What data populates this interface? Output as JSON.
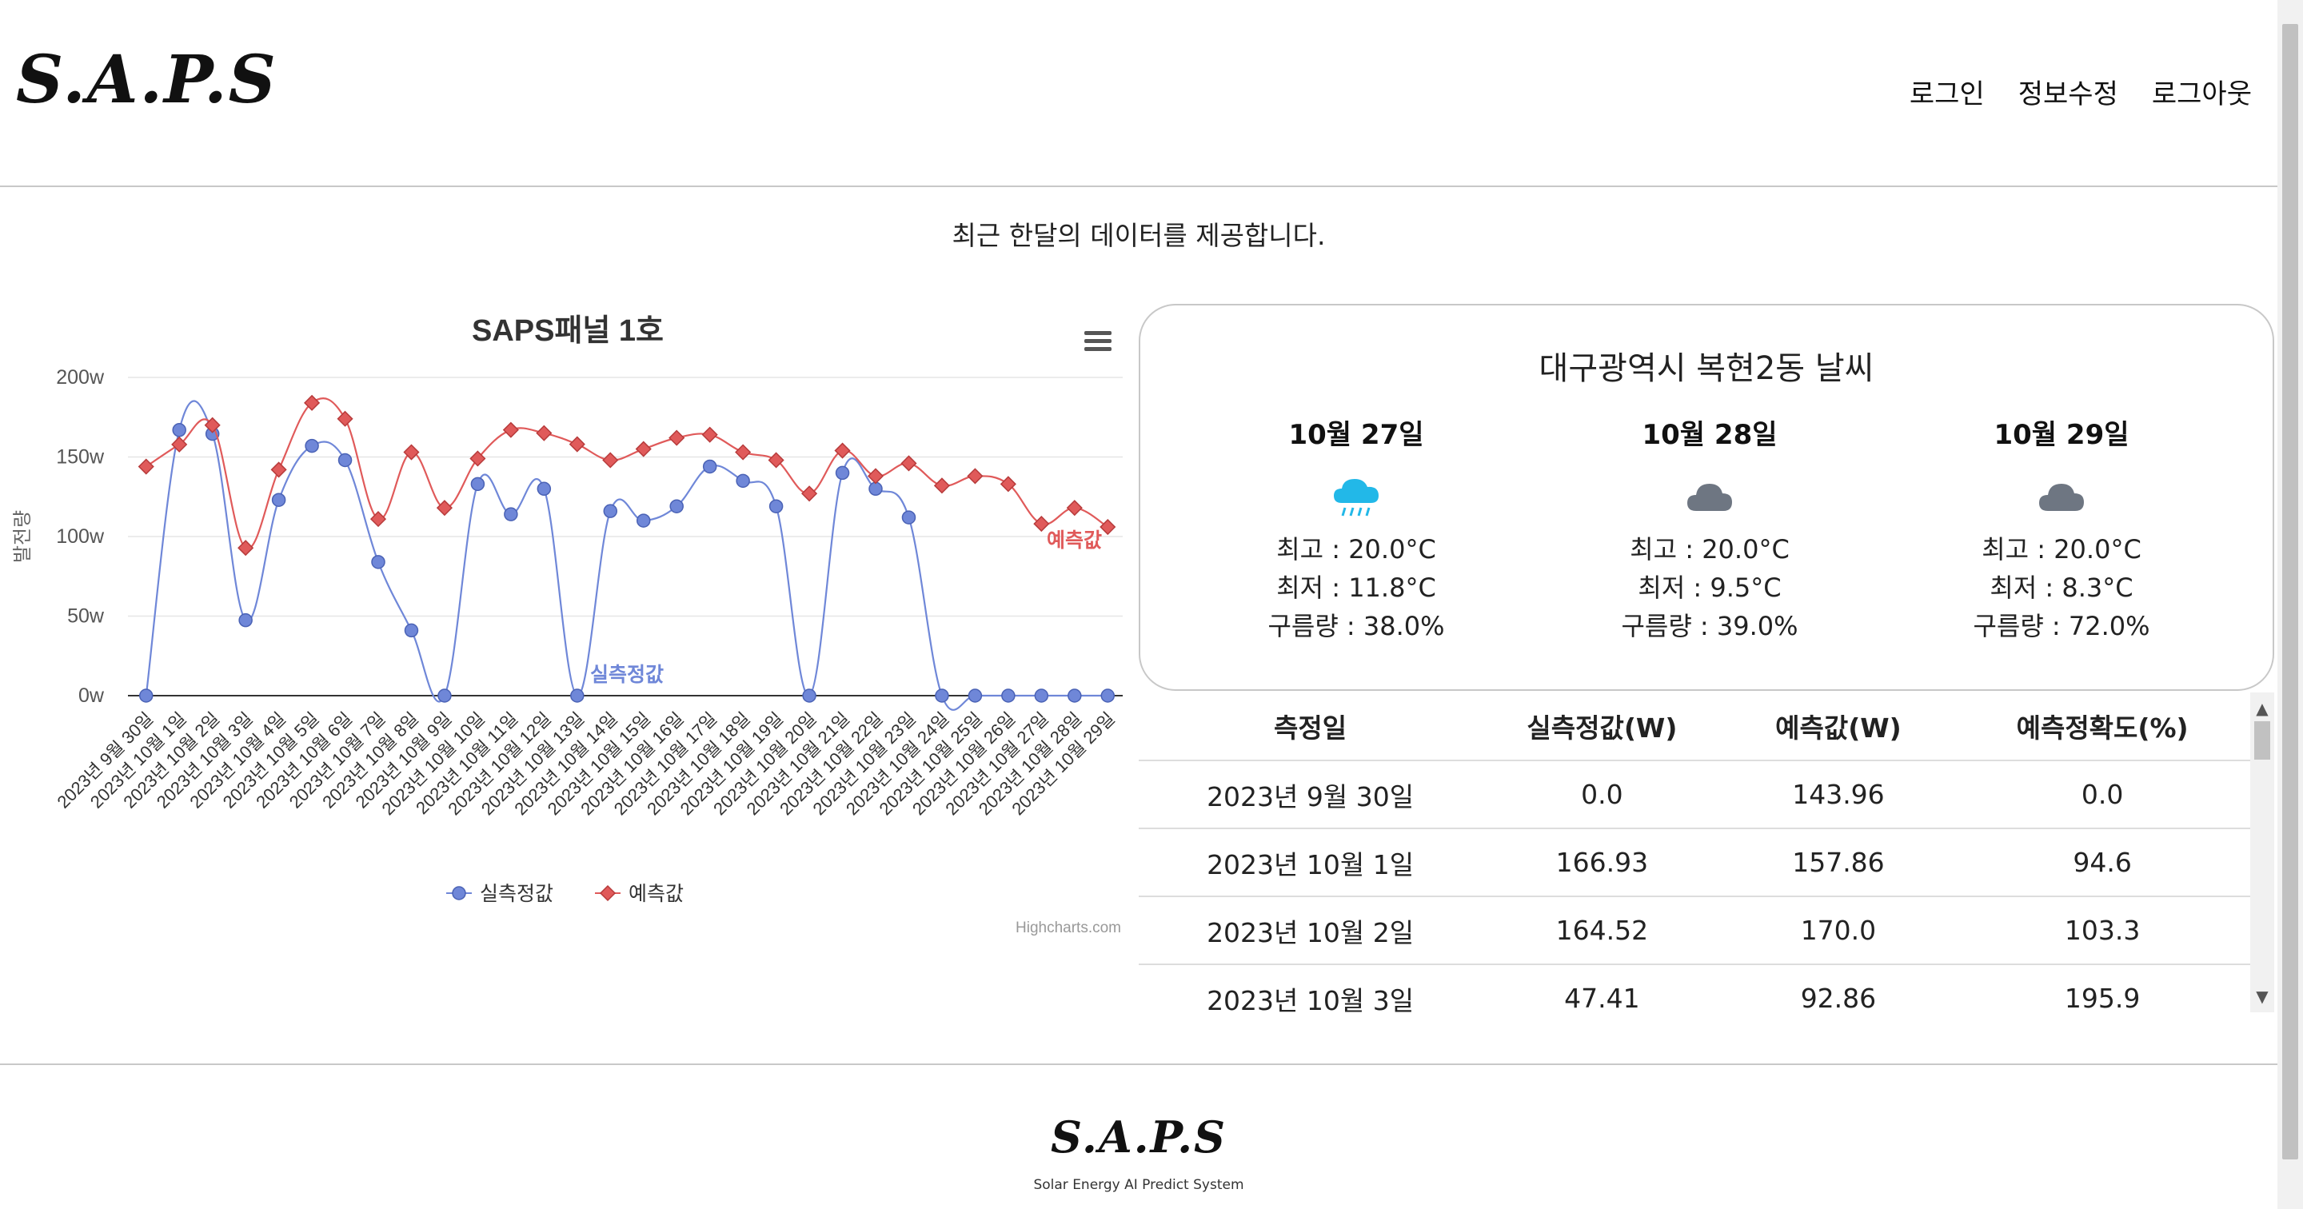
{
  "header": {
    "logo": "S.A.P.S",
    "nav": [
      "로그인",
      "정보수정",
      "로그아웃"
    ]
  },
  "intro": "최근 한달의 데이터를 제공합니다.",
  "chart_data": {
    "type": "line",
    "title": "SAPS패널 1호",
    "ylabel": "발전량",
    "ylim": [
      0,
      200
    ],
    "yticks": [
      "0w",
      "50w",
      "100w",
      "150w",
      "200w"
    ],
    "categories": [
      "2023년 9월 30일",
      "2023년 10월 1일",
      "2023년 10월 2일",
      "2023년 10월 3일",
      "2023년 10월 4일",
      "2023년 10월 5일",
      "2023년 10월 6일",
      "2023년 10월 7일",
      "2023년 10월 8일",
      "2023년 10월 9일",
      "2023년 10월 10일",
      "2023년 10월 11일",
      "2023년 10월 12일",
      "2023년 10월 13일",
      "2023년 10월 14일",
      "2023년 10월 15일",
      "2023년 10월 16일",
      "2023년 10월 17일",
      "2023년 10월 18일",
      "2023년 10월 19일",
      "2023년 10월 20일",
      "2023년 10월 21일",
      "2023년 10월 22일",
      "2023년 10월 23일",
      "2023년 10월 24일",
      "2023년 10월 25일",
      "2023년 10월 26일",
      "2023년 10월 27일",
      "2023년 10월 28일",
      "2023년 10월 29일"
    ],
    "series": [
      {
        "name": "실측정값",
        "color": "#6f87d8",
        "marker": "circle",
        "values": [
          0,
          166.93,
          164.52,
          47.41,
          123,
          157,
          148,
          84,
          41,
          0,
          133,
          114,
          130,
          0,
          116,
          110,
          119,
          144,
          135,
          119,
          0,
          140,
          130,
          112,
          0,
          0,
          0,
          0,
          0,
          0
        ]
      },
      {
        "name": "예측값",
        "color": "#e05a5a",
        "marker": "diamond",
        "values": [
          143.96,
          157.86,
          170.0,
          92.86,
          142,
          184,
          174,
          111,
          153,
          118,
          149,
          167,
          165,
          158,
          148,
          155,
          162,
          164,
          153,
          148,
          127,
          154,
          138,
          146,
          132,
          138,
          133,
          108,
          118,
          106
        ]
      }
    ],
    "credit": "Highcharts.com",
    "legend": "bottom-center",
    "grid": true
  },
  "weather": {
    "title": "대구광역시 복현2동 날씨",
    "days": [
      {
        "date": "10월 27일",
        "icon": "rain-cloud-icon",
        "high": "최고 : 20.0°C",
        "low": "최저 : 11.8°C",
        "cloud": "구름량 : 38.0%"
      },
      {
        "date": "10월 28일",
        "icon": "cloud-icon",
        "high": "최고 : 20.0°C",
        "low": "최저 : 9.5°C",
        "cloud": "구름량 : 39.0%"
      },
      {
        "date": "10월 29일",
        "icon": "cloud-icon",
        "high": "최고 : 20.0°C",
        "low": "최저 : 8.3°C",
        "cloud": "구름량 : 72.0%"
      }
    ]
  },
  "table": {
    "headers": [
      "측정일",
      "실측정값(W)",
      "예측값(W)",
      "예측정확도(%)"
    ],
    "rows": [
      [
        "2023년 9월 30일",
        "0.0",
        "143.96",
        "0.0"
      ],
      [
        "2023년 10월 1일",
        "166.93",
        "157.86",
        "94.6"
      ],
      [
        "2023년 10월 2일",
        "164.52",
        "170.0",
        "103.3"
      ],
      [
        "2023년 10월 3일",
        "47.41",
        "92.86",
        "195.9"
      ]
    ]
  },
  "footer": {
    "logo": "S.A.P.S",
    "subtitle": "Solar Energy AI Predict System"
  }
}
